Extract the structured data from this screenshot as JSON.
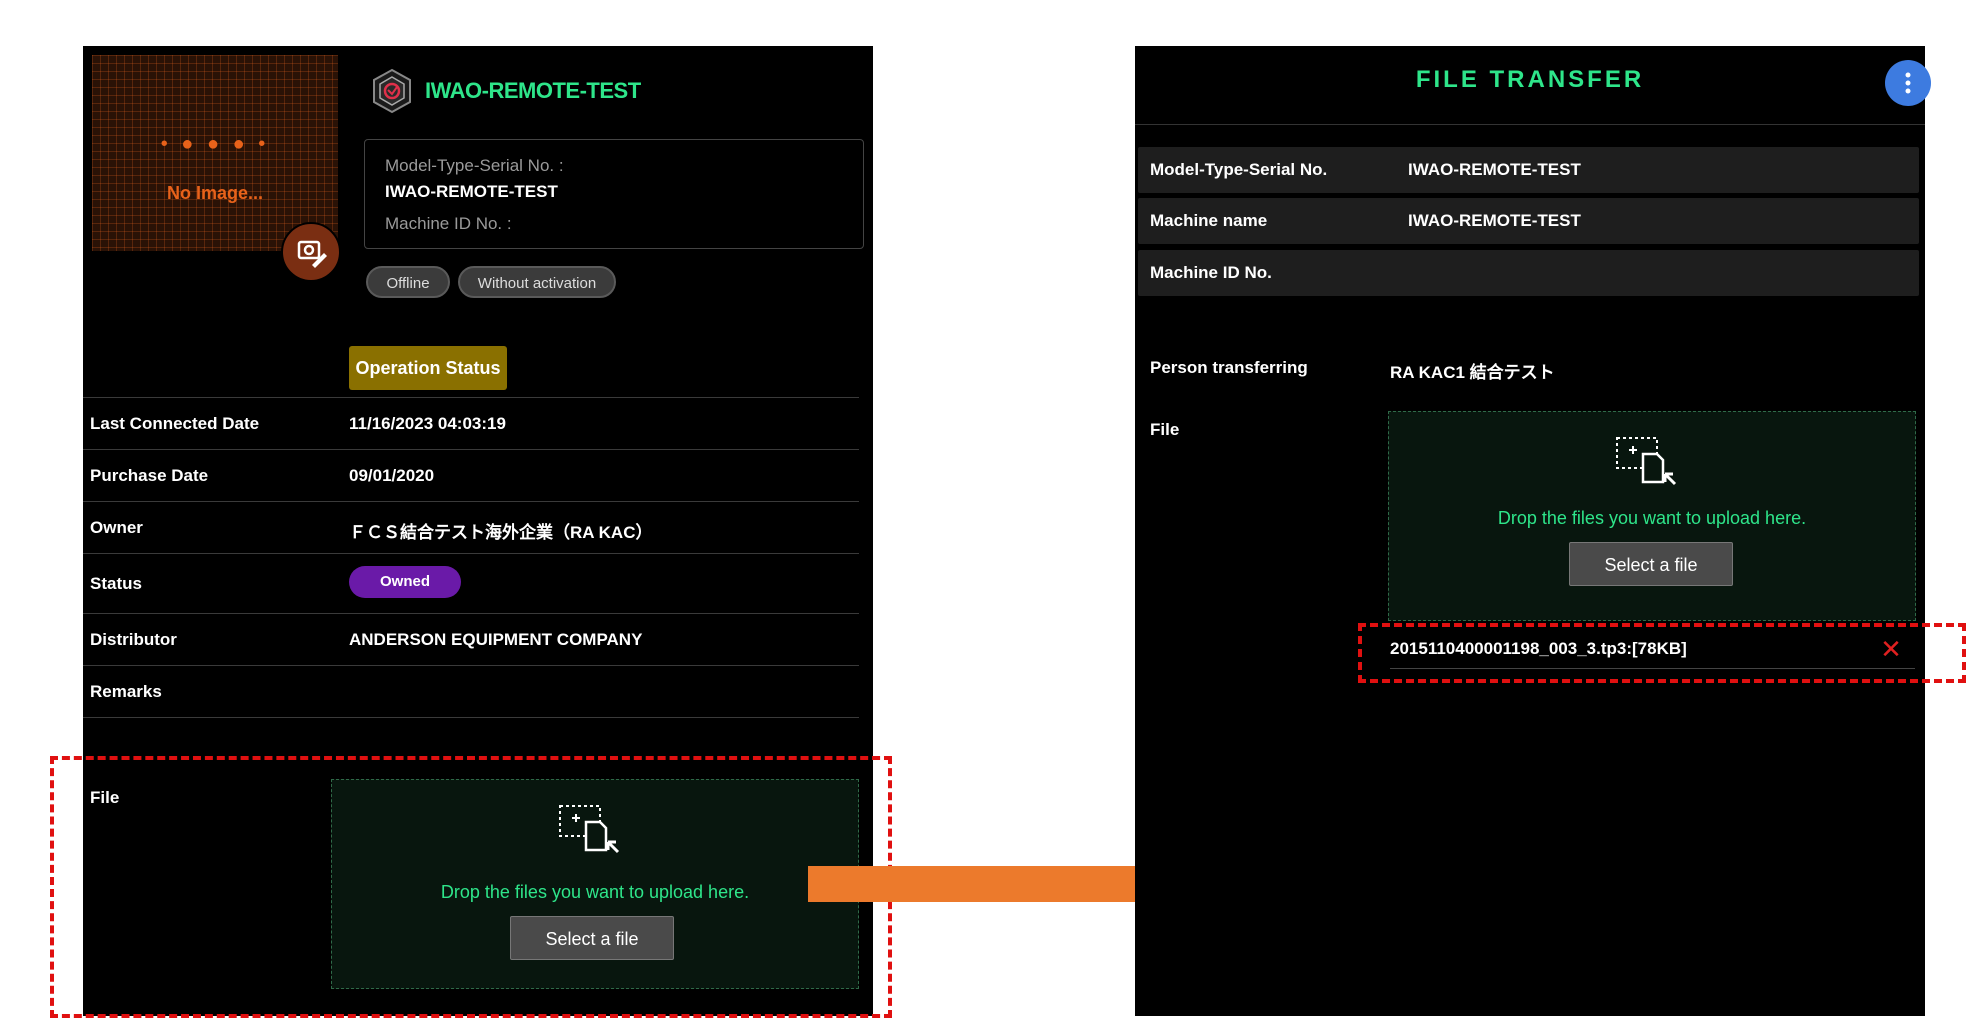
{
  "left": {
    "image_placeholder": {
      "dots": "• ● ● ● •",
      "text": "No Image..."
    },
    "machine_title": "IWAO-REMOTE-TEST",
    "info": {
      "model_label": "Model-Type-Serial No. :",
      "model_value": "IWAO-REMOTE-TEST",
      "machine_id_label": "Machine ID No. :"
    },
    "pills": [
      "Offline",
      "Without activation"
    ],
    "operation_status_button": "Operation Status",
    "rows": [
      {
        "label": "Last Connected Date",
        "value": "11/16/2023 04:03:19"
      },
      {
        "label": "Purchase Date",
        "value": "09/01/2020"
      },
      {
        "label": "Owner",
        "value": "ＦＣＳ結合テスト海外企業（RA KAC）"
      },
      {
        "label": "Status",
        "value": "Owned"
      },
      {
        "label": "Distributor",
        "value": "ANDERSON EQUIPMENT COMPANY"
      },
      {
        "label": "Remarks",
        "value": ""
      }
    ],
    "file_label": "File",
    "drop_text": "Drop the files you want to upload here.",
    "select_file_button": "Select a file"
  },
  "right": {
    "title": "FILE TRANSFER",
    "menu_icon": "more-vertical-icon",
    "rows": [
      {
        "label": "Model-Type-Serial No.",
        "value": "IWAO-REMOTE-TEST"
      },
      {
        "label": "Machine name",
        "value": "IWAO-REMOTE-TEST"
      },
      {
        "label": "Machine ID No.",
        "value": ""
      }
    ],
    "person_label": "Person transferring",
    "person_value": "RA KAC1 結合テスト",
    "file_label": "File",
    "drop_text": "Drop the files you want to upload here.",
    "select_file_button": "Select a file",
    "uploaded_file": "2015110400001198_003_3.tp3:[78KB]",
    "remove_icon": "close-icon"
  },
  "colors": {
    "accent_green": "#2ee58a",
    "panel_bg": "#000000",
    "highlight_red": "#e01010",
    "arrow_orange": "#ec7a2c",
    "owned_purple": "#6a1aa8",
    "operation_gold": "#8a7000",
    "menu_blue": "#3d7be0"
  }
}
